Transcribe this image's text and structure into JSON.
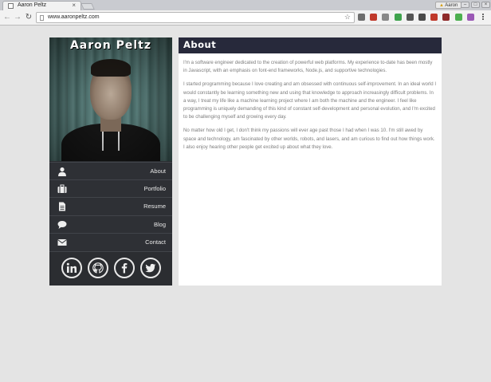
{
  "browser": {
    "tab_title": "Aaron Peltz",
    "tab_close": "×",
    "profile_label": "Aaron",
    "url": "www.aaronpeltz.com",
    "extension_colors": [
      "#6d6d6d",
      "#c0392b",
      "#888888",
      "#3fa34d",
      "#555555",
      "#4a4a4a",
      "#c0392b",
      "#8e2a2a",
      "#4caf50",
      "#9b59b6"
    ]
  },
  "sidebar": {
    "name": "Aaron Peltz",
    "nav": [
      {
        "label": "About",
        "icon": "user-icon"
      },
      {
        "label": "Portfolio",
        "icon": "briefcase-icon"
      },
      {
        "label": "Resume",
        "icon": "document-icon"
      },
      {
        "label": "Blog",
        "icon": "speech-bubble-icon"
      },
      {
        "label": "Contact",
        "icon": "envelope-icon"
      }
    ],
    "social": [
      {
        "name": "linkedin-icon"
      },
      {
        "name": "github-icon"
      },
      {
        "name": "facebook-icon"
      },
      {
        "name": "twitter-icon"
      }
    ]
  },
  "content": {
    "title": "About",
    "paragraphs": [
      "I'm a software engineer dedicated to the creation of powerful web platforms. My experience to-date has been mostly in Javascript, with an emphasis on font-end frameworks, Node.js, and supportive technologies.",
      "I started programming because I love creating and am obsessed with continuous self-improvement. In an ideal world I would constantly be learning something new and using that knowledge to approach increasingly difficult problems. In a way, I treat my life like a machine learning project where I am both the machine and the engineer. I feel like programming is uniquely demanding of this kind of constant self-development and personal evolution, and I'm excited to be challenging myself and growing every day.",
      "No matter how old I get, I don't think my passions will ever age past those I had when I was 10. I'm still awed by space and technology, am fascinated by other worlds, robots, and lasers, and am curious to find out how things work. I also enjoy hearing other people get excited up about what they love."
    ]
  },
  "colors": {
    "sidebar_bg": "#2b2d31",
    "header_bg": "#27293b",
    "page_bg": "#e4e4e4",
    "body_text": "#7d7d7d"
  }
}
